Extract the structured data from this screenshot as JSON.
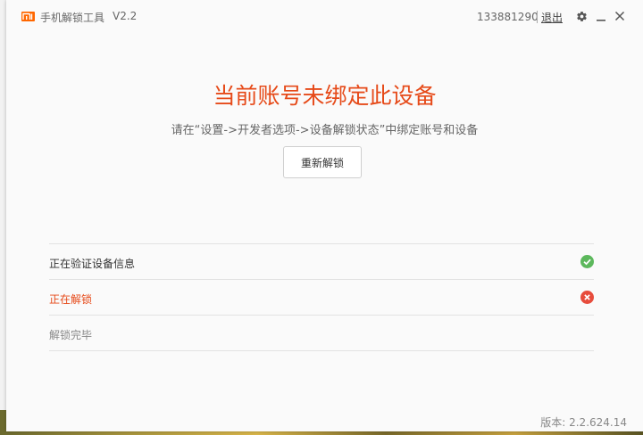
{
  "app": {
    "title": "手机解锁工具",
    "version": "V2.2",
    "account_id": "133881290",
    "logout_label": "退出"
  },
  "icons": {
    "logo": "mi-logo",
    "settings": "gear-icon",
    "minimize": "minimize-icon",
    "close": "close-icon"
  },
  "message": {
    "headline": "当前账号未绑定此设备",
    "instruction": "请在“设置->开发者选项->设备解锁状态”中绑定账号和设备",
    "retry_button": "重新解锁"
  },
  "steps": [
    {
      "label": "正在验证设备信息",
      "status": "success"
    },
    {
      "label": "正在解锁",
      "status": "error"
    },
    {
      "label": "解锁完毕",
      "status": "pending"
    }
  ],
  "colors": {
    "accent": "#e64a19",
    "success": "#5cb85c",
    "error": "#e74c3c",
    "muted": "#888888"
  },
  "footer": {
    "version_text": "版本: 2.2.624.14"
  }
}
